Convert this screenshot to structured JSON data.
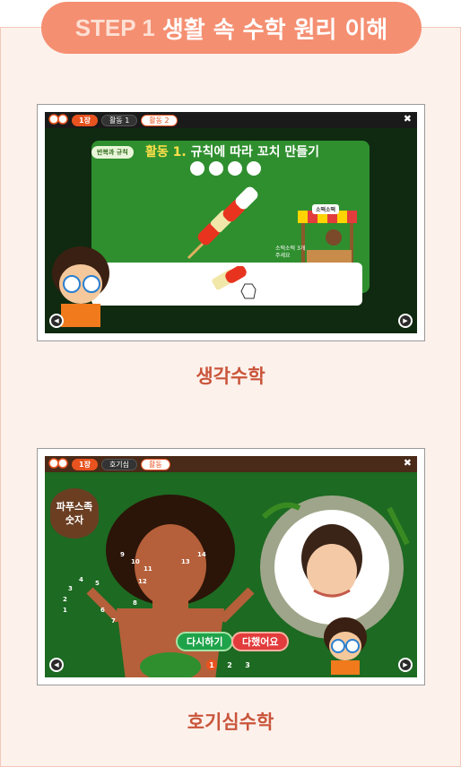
{
  "header": {
    "step": "STEP 1",
    "title": "생활 속 수학 원리 이해"
  },
  "screen1": {
    "chapter": "1장",
    "tabs": [
      "활동 1",
      "활동 2"
    ],
    "tag": "반복과 규칙",
    "activity_no": "활동 1.",
    "activity_title": "규칙에 따라 꼬치 만들기",
    "shop_label": "소떡소떡",
    "shop_note_line1": "소떡소떡 3개",
    "shop_note_line2": "주세요"
  },
  "caption1": "생각수학",
  "screen2": {
    "chapter": "1장",
    "tabs": [
      "호기심",
      "활동"
    ],
    "title_line1": "파푸스족",
    "title_line2": "숫자",
    "retry": "다시하기",
    "done": "다했어요",
    "pages": [
      "1",
      "2",
      "3"
    ],
    "numbers": [
      "1",
      "2",
      "3",
      "4",
      "5",
      "6",
      "7",
      "8",
      "9",
      "10",
      "11",
      "12",
      "13",
      "14"
    ]
  },
  "caption2": "호기심수학",
  "colors": {
    "accent": "#f58f72",
    "caption": "#c9553a",
    "board_green": "#2f8f2f"
  }
}
